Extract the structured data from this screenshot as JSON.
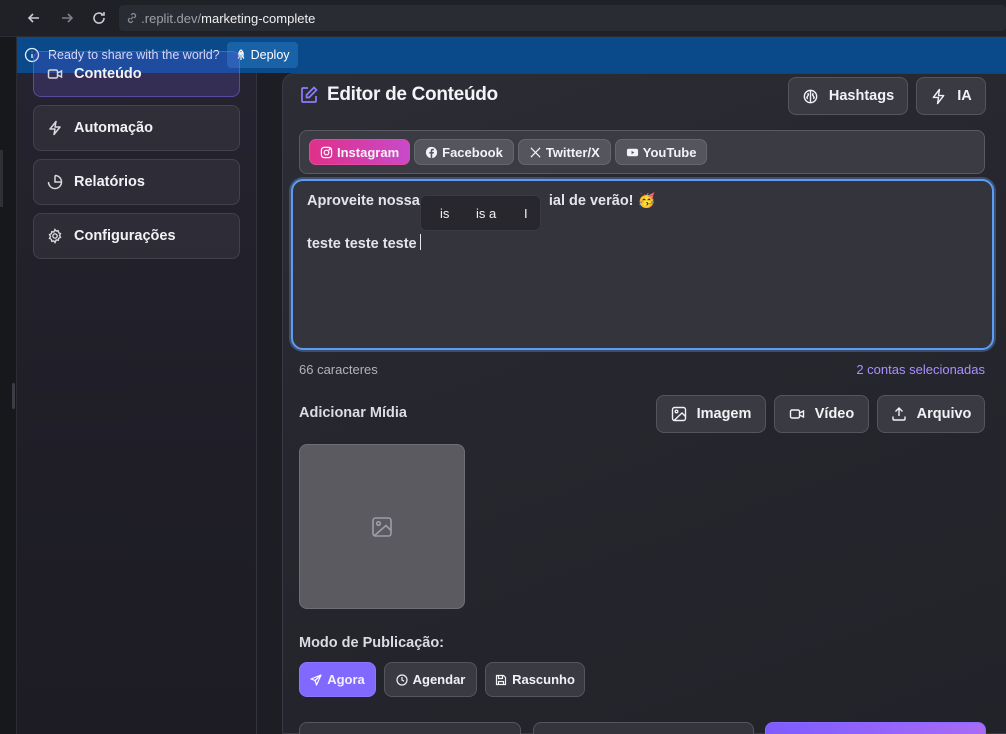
{
  "browser": {
    "url_prefix": ".replit.dev/",
    "url_path": "marketing-complete"
  },
  "banner": {
    "message": "Ready to share with the world?",
    "deploy_label": "Deploy"
  },
  "sidebar": {
    "items": [
      {
        "label": "Conteúdo",
        "icon": "video-icon",
        "active": true
      },
      {
        "label": "Automação",
        "icon": "bolt-icon",
        "active": false
      },
      {
        "label": "Relatórios",
        "icon": "pie-chart-icon",
        "active": false
      },
      {
        "label": "Configurações",
        "icon": "gear-icon",
        "active": false
      }
    ]
  },
  "editor": {
    "title": "Editor de Conteúdo",
    "hashtags_label": "Hashtags",
    "ai_label": "IA",
    "platforms": [
      {
        "label": "Instagram",
        "icon": "instagram-icon",
        "active": true
      },
      {
        "label": "Facebook",
        "icon": "facebook-icon",
        "active": false
      },
      {
        "label": "Twitter/X",
        "icon": "x-icon",
        "active": false
      },
      {
        "label": "YouTube",
        "icon": "youtube-icon",
        "active": false
      }
    ],
    "text_line_1_start": "Aproveite nossa",
    "text_line_1_end": "ial de verão! 🥳",
    "text_line_2": "teste teste teste",
    "spell_suggestions": [
      "is",
      "is a",
      "I"
    ],
    "char_count": "66 caracteres",
    "selected_accounts": "2 contas selecionadas",
    "accent_color": "#8169ff",
    "focus_color": "#5d9cf0"
  },
  "media": {
    "label": "Adicionar Mídia",
    "buttons": [
      {
        "label": "Imagem",
        "icon": "image-icon"
      },
      {
        "label": "Vídeo",
        "icon": "video-icon"
      },
      {
        "label": "Arquivo",
        "icon": "upload-icon"
      }
    ]
  },
  "publish": {
    "mode_label": "Modo de Publicação:",
    "modes": [
      {
        "label": "Agora",
        "icon": "send-icon",
        "active": true
      },
      {
        "label": "Agendar",
        "icon": "clock-icon",
        "active": false
      },
      {
        "label": "Rascunho",
        "icon": "save-icon",
        "active": false
      }
    ]
  }
}
